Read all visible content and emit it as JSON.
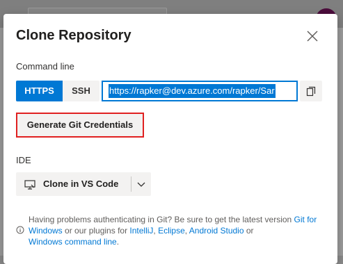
{
  "dialog": {
    "title": "Clone Repository",
    "close_icon": "close-icon"
  },
  "command_line": {
    "label": "Command line",
    "protocols": [
      {
        "label": "HTTPS",
        "selected": true
      },
      {
        "label": "SSH",
        "selected": false
      }
    ],
    "url": "https://rapker@dev.azure.com/rapker/Sar",
    "copy_icon": "copy-icon"
  },
  "generate_button": {
    "label": "Generate Git Credentials"
  },
  "ide": {
    "label": "IDE",
    "clone_button_label": "Clone in VS Code",
    "clone_icon": "monitor-icon",
    "dropdown_icon": "chevron-down-icon"
  },
  "help": {
    "icon": "info-icon",
    "text_before": "Having problems authenticating in Git? Be sure to get the latest version ",
    "link_git_windows": "Git for Windows",
    "text_mid1": " or our plugins for ",
    "link_intellij": "IntelliJ",
    "sep1": ", ",
    "link_eclipse": "Eclipse",
    "sep2": ", ",
    "link_android": "Android Studio",
    "text_or": " or ",
    "link_cmdline": "Windows command line",
    "text_end": "."
  },
  "colors": {
    "accent": "#0078d4",
    "highlight_border": "#e02020"
  }
}
